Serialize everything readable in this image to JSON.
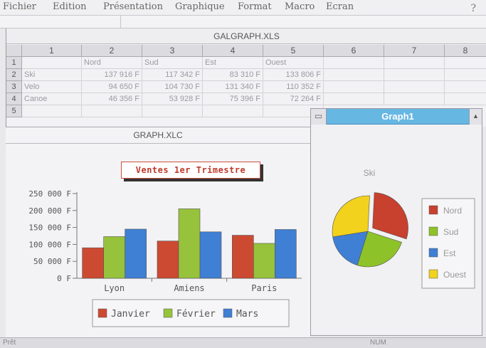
{
  "menubar": {
    "items": [
      "Fichier",
      "Edition",
      "Présentation",
      "Graphique",
      "Format",
      "Macro",
      "Ecran"
    ],
    "help": "?"
  },
  "spreadsheet": {
    "title": "GALGRAPH.XLS",
    "columns": [
      "1",
      "2",
      "3",
      "4",
      "5",
      "6",
      "7",
      "8"
    ],
    "row_numbers": [
      "1",
      "2",
      "3",
      "4",
      "5"
    ],
    "header_row": [
      "",
      "Nord",
      "Sud",
      "Est",
      "Ouest"
    ],
    "rows": [
      [
        "Ski",
        "137 916 F",
        "117 342 F",
        "83 310 F",
        "133 806 F"
      ],
      [
        "Velo",
        "94 650 F",
        "104 730 F",
        "131 340 F",
        "110 352 F"
      ],
      [
        "Canoe",
        "46 356 F",
        "53 928 F",
        "75 396 F",
        "72 264 F"
      ]
    ]
  },
  "graph_window": {
    "title": "GRAPH.XLC"
  },
  "graph1_window": {
    "title": "Graph1",
    "system_button": "▭",
    "maximize_button": "▲"
  },
  "status": {
    "text": "Prêt",
    "num": "NUM"
  },
  "colors": {
    "janvier": "#cc4a32",
    "fevrier": "#97c23c",
    "mars": "#3f7fd4",
    "nord": "#c8402e",
    "sud": "#8ec229",
    "est": "#3f7fd4",
    "ouest": "#f2d21c"
  },
  "chart_data": [
    {
      "type": "bar",
      "title": "Ventes 1er Trimestre",
      "categories": [
        "Lyon",
        "Amiens",
        "Paris"
      ],
      "series": [
        {
          "name": "Janvier",
          "values": [
            90000,
            110000,
            127000
          ]
        },
        {
          "name": "Février",
          "values": [
            123000,
            205000,
            103000
          ]
        },
        {
          "name": "Mars",
          "values": [
            145000,
            137000,
            144000
          ]
        }
      ],
      "yticks": [
        "250 000 F",
        "200 000 F",
        "150 000 F",
        "100 000 F",
        "50 000 F",
        "0 F"
      ],
      "ylim": [
        0,
        250000
      ],
      "legend_position": "bottom",
      "grid": false
    },
    {
      "type": "pie",
      "title": "Ski",
      "labels": [
        "Nord",
        "Sud",
        "Est",
        "Ouest"
      ],
      "values": [
        137916,
        117342,
        83310,
        133806
      ],
      "exploded": "Nord",
      "legend_position": "right"
    }
  ]
}
